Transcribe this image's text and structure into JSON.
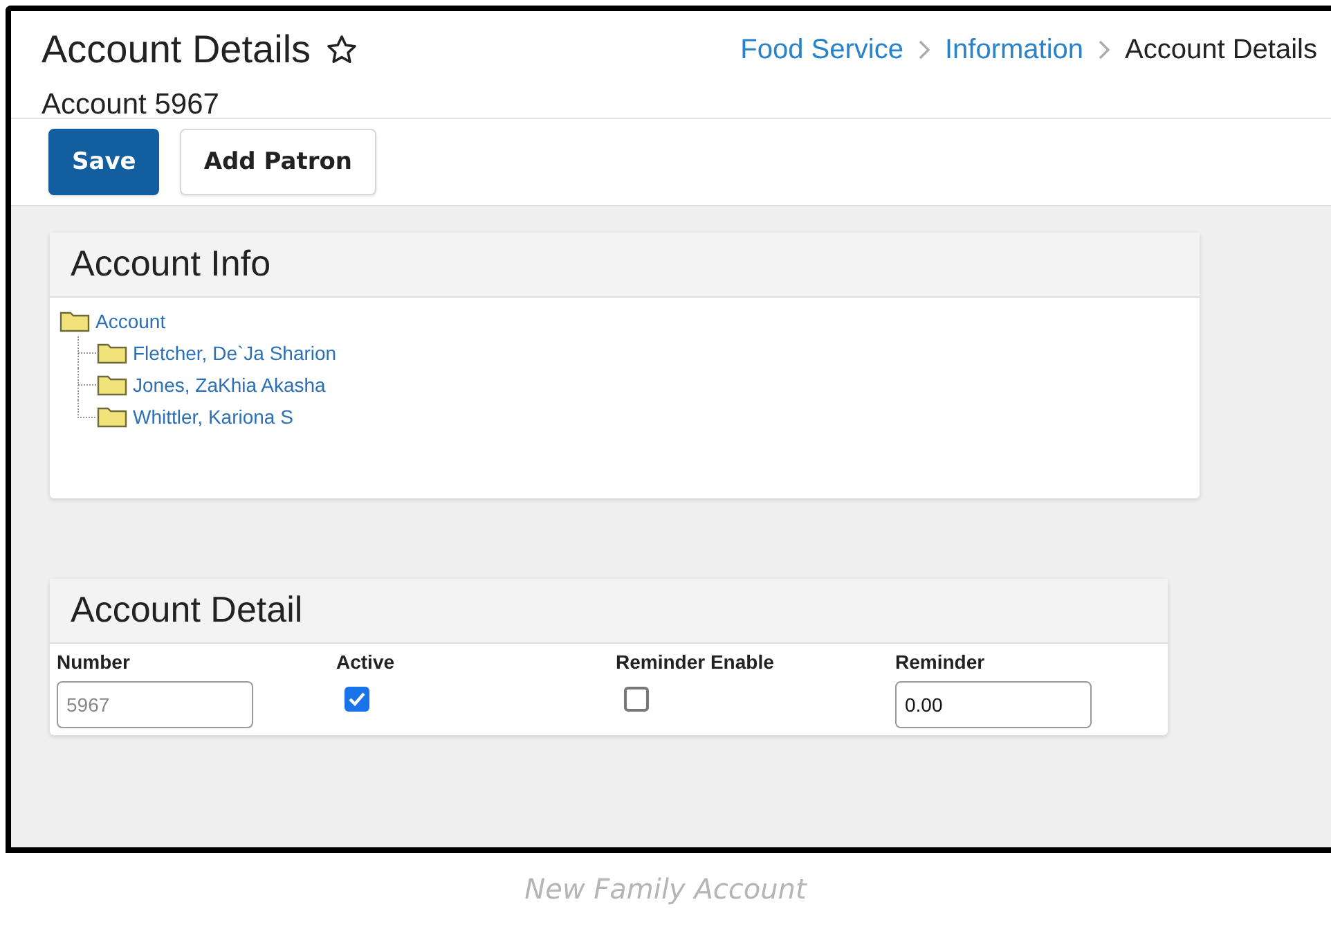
{
  "page": {
    "title": "Account Details",
    "subtitle": "Account 5967",
    "breadcrumb": [
      {
        "label": "Food Service",
        "link": true
      },
      {
        "label": "Information",
        "link": true
      },
      {
        "label": "Account Details",
        "link": false
      }
    ]
  },
  "toolbar": {
    "buttons": [
      {
        "label": "Save",
        "kind": "primary"
      },
      {
        "label": "Add Patron",
        "kind": "secondary"
      }
    ]
  },
  "account_info": {
    "title": "Account Info",
    "tree": [
      {
        "label": "Account",
        "children": [
          {
            "label": "Fletcher, De`Ja Sharion"
          },
          {
            "label": "Jones, ZaKhia Akasha"
          },
          {
            "label": "Whittler, Kariona S"
          }
        ]
      }
    ]
  },
  "account_detail": {
    "title": "Account Detail",
    "fields": [
      {
        "label": "Number",
        "kind": "text",
        "value": "5967",
        "disabled": true
      },
      {
        "label": "Active",
        "kind": "checkbox",
        "checked": true
      },
      {
        "label": "Reminder Enable",
        "kind": "checkbox",
        "checked": false
      },
      {
        "label": "Reminder",
        "kind": "text",
        "value": "0.00",
        "disabled": false
      }
    ]
  },
  "caption": "New Family Account"
}
